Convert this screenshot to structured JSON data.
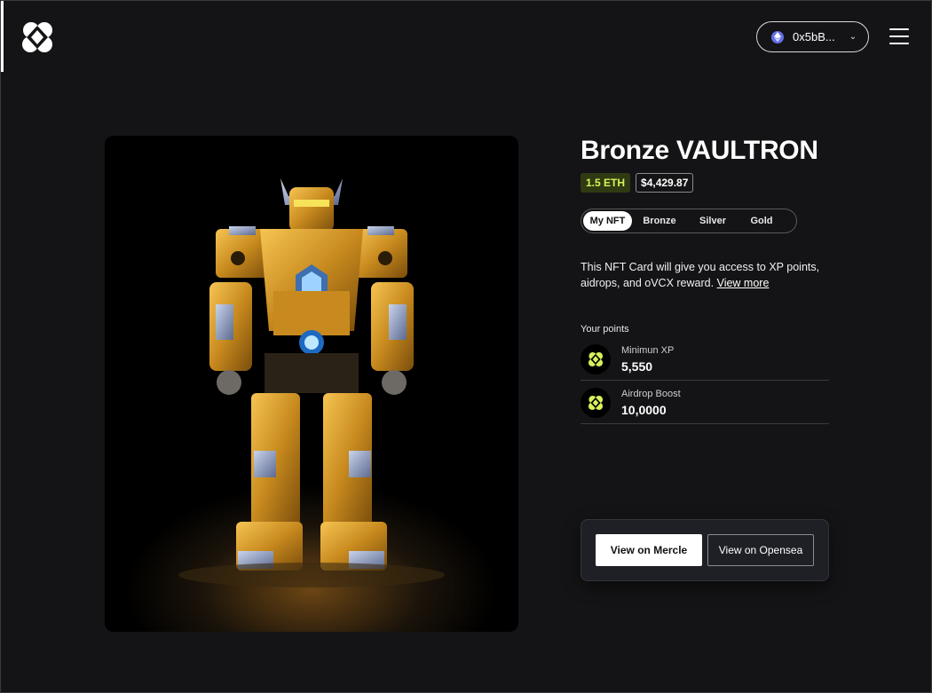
{
  "header": {
    "logo_icon": "vaultcraft-logo-icon",
    "wallet": {
      "address": "0x5bB...",
      "network_icon": "ethereum-icon",
      "chevron": "chevron-down-icon",
      "chevron_glyph": "⌄"
    },
    "menu_icon": "hamburger-menu-icon"
  },
  "nft": {
    "title": "Bronze VAULTRON",
    "price_eth": "1.5 ETH",
    "price_usd": "$4,429.87",
    "image_alt": "golden robot render"
  },
  "tabs": [
    {
      "label": "My NFT",
      "active": true
    },
    {
      "label": "Bronze",
      "active": false
    },
    {
      "label": "Silver",
      "active": false
    },
    {
      "label": "Gold",
      "active": false
    }
  ],
  "description": {
    "text": "This NFT Card will give you access to XP points, aidrops, and oVCX reward.",
    "link": "View more"
  },
  "points": {
    "label": "Your points",
    "items": [
      {
        "name": "Minimun XP",
        "value": "5,550",
        "icon": "vaultcraft-logo-icon"
      },
      {
        "name": "Airdrop Boost",
        "value": "10,0000",
        "icon": "vaultcraft-logo-icon"
      }
    ]
  },
  "actions": {
    "primary": "View on Mercle",
    "secondary": "View on Opensea"
  },
  "colors": {
    "background": "#141416",
    "accent_lime": "#d7f25b",
    "eth_badge_bg": "#2f3a12",
    "panel": "#1f2026",
    "gold": "#e0a532"
  }
}
